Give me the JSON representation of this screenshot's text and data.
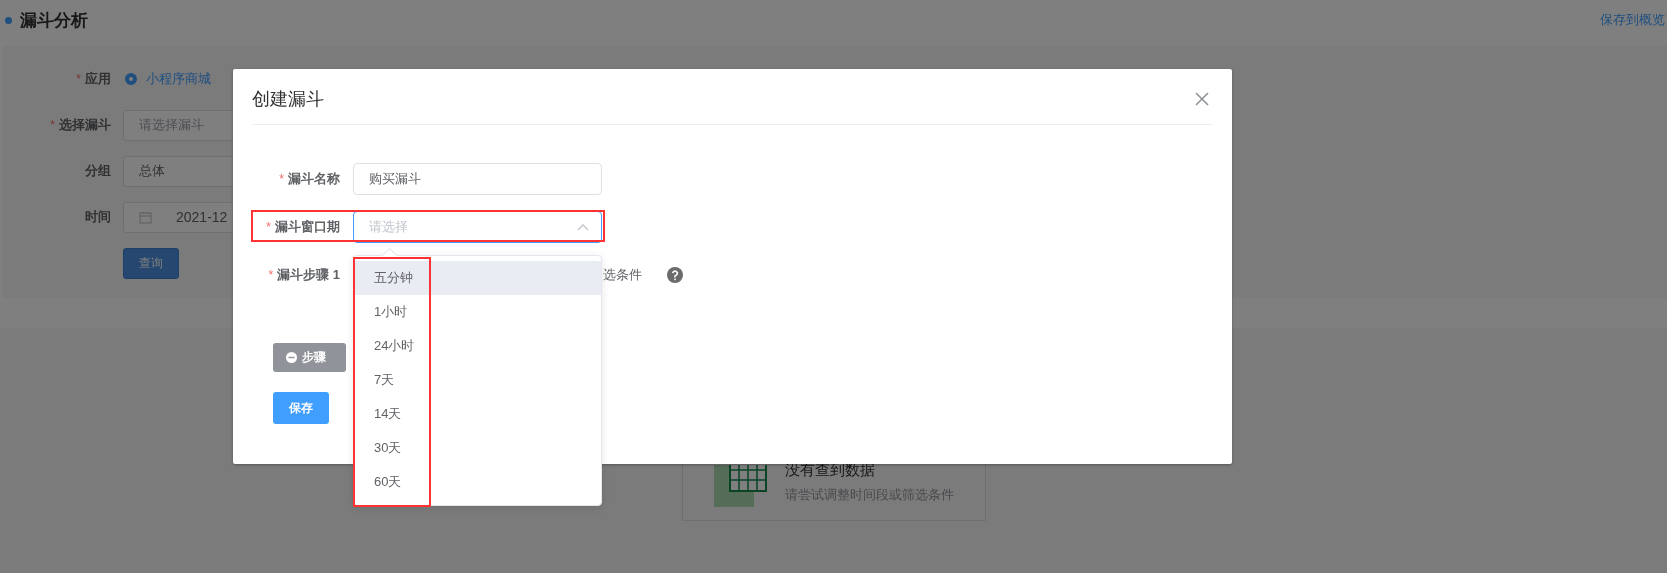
{
  "page_title": "漏斗分析",
  "save_link": "保存到概览",
  "query_form": {
    "fields": [
      {
        "kind": "radio",
        "label": "应用",
        "required_mark": "*",
        "options": [
          {
            "label": "小程序商城",
            "selected": true
          }
        ]
      },
      {
        "kind": "select",
        "label": "选择漏斗",
        "required_mark": "*",
        "placeholder": "请选择漏斗"
      },
      {
        "kind": "select",
        "label": "分组",
        "value": "总体"
      },
      {
        "kind": "date",
        "label": "时间",
        "value": "2021-12"
      }
    ],
    "query_button": "查询"
  },
  "empty_state": {
    "title": "没有查到数据",
    "hint": "请尝试调整时间段或筛选条件"
  },
  "dialog": {
    "title": "创建漏斗",
    "fields": [
      {
        "kind": "input",
        "label": "漏斗名称",
        "required_mark": "*",
        "value": "购买漏斗"
      },
      {
        "kind": "select",
        "label": "漏斗窗口期",
        "required_mark": "*",
        "placeholder": "请选择",
        "expanded": true,
        "highlighted": true
      },
      {
        "kind": "step",
        "label": "漏斗步骤 1",
        "required_mark": "*",
        "trailing_text": "选条件"
      }
    ],
    "dropdown": {
      "highlighted": true,
      "options": [
        {
          "label": "五分钟",
          "hovered": true
        },
        {
          "label": "1小时",
          "hovered": false
        },
        {
          "label": "24小时",
          "hovered": false
        },
        {
          "label": "7天",
          "hovered": false
        },
        {
          "label": "14天",
          "hovered": false
        },
        {
          "label": "30天",
          "hovered": false
        },
        {
          "label": "60天",
          "hovered": false
        }
      ]
    },
    "step_button": "步骤",
    "save_button": "保存"
  }
}
